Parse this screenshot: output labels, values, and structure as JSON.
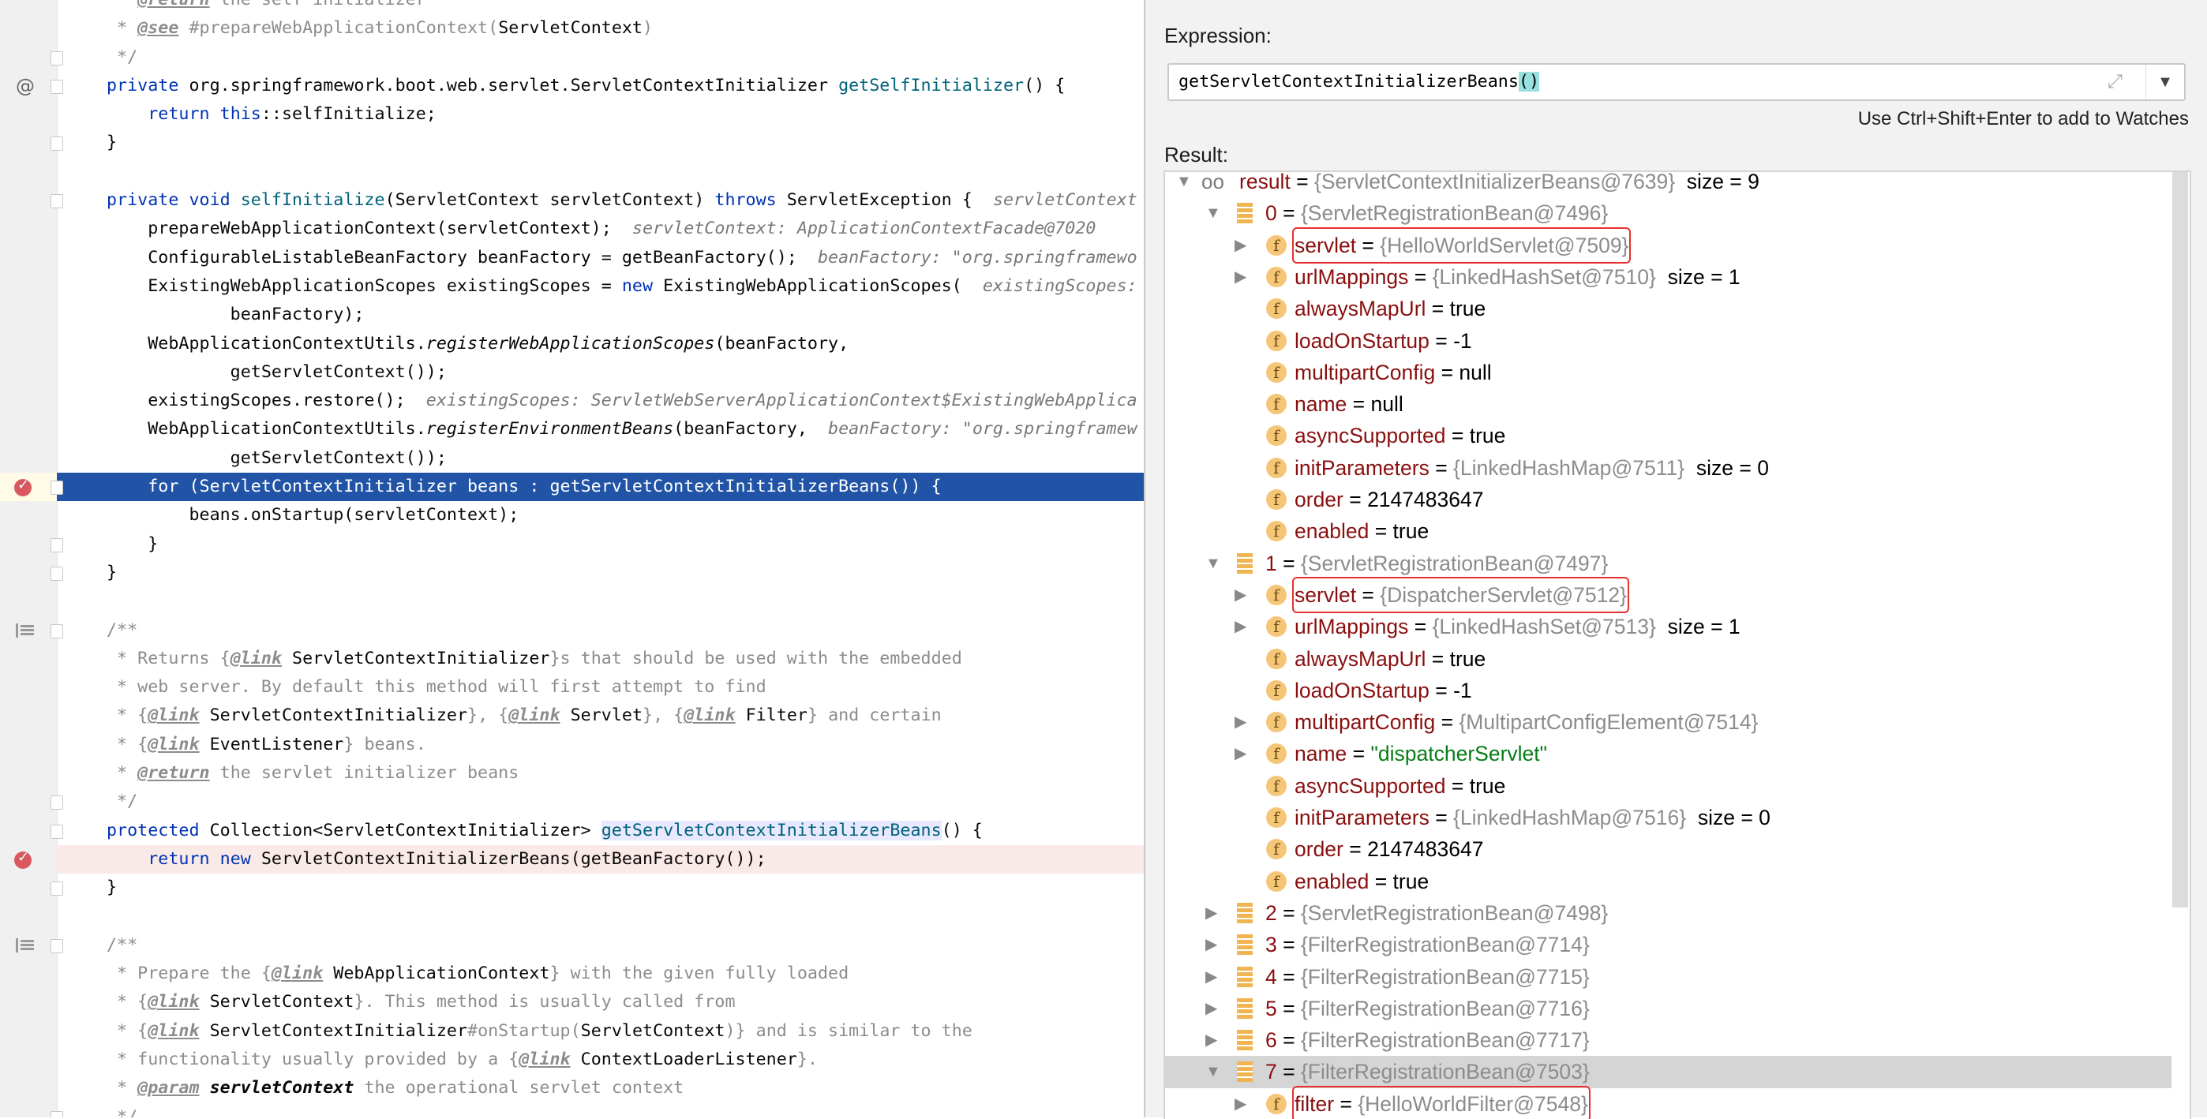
{
  "editor": {
    "lines": [
      [
        [
          " * ",
          "c"
        ],
        [
          "@return",
          "t"
        ],
        [
          " the self initializer",
          "c"
        ]
      ],
      [
        [
          " * ",
          "c"
        ],
        [
          "@see",
          "t"
        ],
        [
          " #prepareWebApplicationContext(",
          "c"
        ],
        [
          "ServletContext",
          "p"
        ],
        [
          ")",
          "c"
        ]
      ],
      [
        [
          " */",
          "c"
        ]
      ],
      [
        [
          "private",
          "k"
        ],
        [
          " org.springframework.boot.web.servlet.ServletContextInitializer ",
          "p"
        ],
        [
          "getSelfInitializer",
          "m"
        ],
        [
          "() {",
          "p"
        ]
      ],
      [
        [
          "    ",
          "p"
        ],
        [
          "return",
          "k"
        ],
        [
          " ",
          "p"
        ],
        [
          "this",
          "k"
        ],
        [
          "::selfInitialize;",
          "p"
        ]
      ],
      [
        [
          "}",
          "p"
        ]
      ],
      [],
      [
        [
          "private void",
          "k"
        ],
        [
          " ",
          "p"
        ],
        [
          "selfInitialize",
          "m"
        ],
        [
          "(ServletContext servletContext) ",
          "p"
        ],
        [
          "throws",
          "k"
        ],
        [
          " ServletException {  ",
          "p"
        ],
        [
          "servletContext",
          "h"
        ]
      ],
      [
        [
          "    prepareWebApplicationContext(servletContext);  ",
          "p"
        ],
        [
          "servletContext: ApplicationContextFacade@7020",
          "h"
        ]
      ],
      [
        [
          "    ConfigurableListableBeanFactory beanFactory = getBeanFactory();  ",
          "p"
        ],
        [
          "beanFactory: \"org.springframewo",
          "h"
        ]
      ],
      [
        [
          "    ExistingWebApplicationScopes existingScopes = ",
          "p"
        ],
        [
          "new",
          "k"
        ],
        [
          " ExistingWebApplicationScopes(  ",
          "p"
        ],
        [
          "existingScopes:",
          "h"
        ]
      ],
      [
        [
          "            beanFactory);",
          "p"
        ]
      ],
      [
        [
          "    WebApplicationContextUtils.",
          "p"
        ],
        [
          "registerWebApplicationScopes",
          "i"
        ],
        [
          "(beanFactory,",
          "p"
        ]
      ],
      [
        [
          "            getServletContext());",
          "p"
        ]
      ],
      [
        [
          "    existingScopes.restore();  ",
          "p"
        ],
        [
          "existingScopes: ServletWebServerApplicationContext$ExistingWebApplica",
          "h"
        ]
      ],
      [
        [
          "    WebApplicationContextUtils.",
          "p"
        ],
        [
          "registerEnvironmentBeans",
          "i"
        ],
        [
          "(beanFactory,  ",
          "p"
        ],
        [
          "beanFactory: \"org.springframew",
          "h"
        ]
      ],
      [
        [
          "            getServletContext());",
          "p"
        ]
      ],
      [
        [
          "    for (ServletContextInitializer beans : getServletContextInitializerBeans()) {",
          "p"
        ]
      ],
      [
        [
          "        beans.onStartup(servletContext);",
          "p"
        ]
      ],
      [
        [
          "    }",
          "p"
        ]
      ],
      [
        [
          "}",
          "p"
        ]
      ],
      [],
      [
        [
          "/**",
          "c"
        ]
      ],
      [
        [
          " * Returns {",
          "c"
        ],
        [
          "@link",
          "t"
        ],
        [
          " ServletContextInitializer",
          "p"
        ],
        [
          "}s that should be used with the embedded",
          "c"
        ]
      ],
      [
        [
          " * web server. By default this method will first attempt to find",
          "c"
        ]
      ],
      [
        [
          " * {",
          "c"
        ],
        [
          "@link",
          "t"
        ],
        [
          " ServletContextInitializer",
          "p"
        ],
        [
          "}, {",
          "c"
        ],
        [
          "@link",
          "t"
        ],
        [
          " Servlet",
          "p"
        ],
        [
          "}, {",
          "c"
        ],
        [
          "@link",
          "t"
        ],
        [
          " Filter",
          "p"
        ],
        [
          "} and certain",
          "c"
        ]
      ],
      [
        [
          " * {",
          "c"
        ],
        [
          "@link",
          "t"
        ],
        [
          " EventListener",
          "p"
        ],
        [
          "} beans.",
          "c"
        ]
      ],
      [
        [
          " * ",
          "c"
        ],
        [
          "@return",
          "t"
        ],
        [
          " the servlet initializer beans",
          "c"
        ]
      ],
      [
        [
          " */",
          "c"
        ]
      ],
      [
        [
          "protected",
          "k"
        ],
        [
          " Collection<ServletContextInitializer> ",
          "p"
        ],
        [
          "getServletContextInitializerBeans",
          "mh"
        ],
        [
          "() {",
          "p"
        ]
      ],
      [
        [
          "    ",
          "p"
        ],
        [
          "return new",
          "k"
        ],
        [
          " ServletContextInitializerBeans(getBeanFactory());",
          "p"
        ]
      ],
      [
        [
          "}",
          "p"
        ]
      ],
      [],
      [
        [
          "/**",
          "c"
        ]
      ],
      [
        [
          " * Prepare the {",
          "c"
        ],
        [
          "@link",
          "t"
        ],
        [
          " WebApplicationContext",
          "p"
        ],
        [
          "} with the given fully loaded",
          "c"
        ]
      ],
      [
        [
          " * {",
          "c"
        ],
        [
          "@link",
          "t"
        ],
        [
          " ServletContext",
          "p"
        ],
        [
          "}. This method is usually called from",
          "c"
        ]
      ],
      [
        [
          " * {",
          "c"
        ],
        [
          "@link",
          "t"
        ],
        [
          " ServletContextInitializer",
          "p"
        ],
        [
          "#onStartup(",
          "c"
        ],
        [
          "ServletContext",
          "p"
        ],
        [
          ")} and is similar to the",
          "c"
        ]
      ],
      [
        [
          " * functionality usually provided by a {",
          "c"
        ],
        [
          "@link",
          "t"
        ],
        [
          " ContextLoaderListener",
          "p"
        ],
        [
          "}.",
          "c"
        ]
      ],
      [
        [
          " * ",
          "c"
        ],
        [
          "@param",
          "t"
        ],
        [
          " ",
          "p"
        ],
        [
          "servletContext",
          "pb"
        ],
        [
          " the operational servlet context",
          "c"
        ]
      ],
      [
        [
          " */",
          "c"
        ]
      ]
    ],
    "execution_line": 17,
    "breakpoint_lines": [
      17,
      30
    ],
    "override_icon_lines": [
      3
    ],
    "doc_icon_lines": [
      22,
      33
    ],
    "fold_lines": [
      2,
      3,
      5,
      7,
      17,
      19,
      20,
      22,
      28,
      29,
      31,
      33,
      39
    ]
  },
  "evaluate": {
    "expression_label": "Expression:",
    "expression_value": "getServletContextInitializerBeans",
    "expression_parens": "()",
    "hint": "Use Ctrl+Shift+Enter to add to Watches",
    "result_label": "Result:"
  },
  "tree": [
    {
      "level": 0,
      "arrow": "down",
      "icon": "watch",
      "name": "result",
      "value": "{ServletContextInitializerBeans@7639}",
      "vclass": "ref",
      "extra": "size = 9"
    },
    {
      "level": 1,
      "arrow": "down",
      "icon": "array",
      "name": "0",
      "value": "{ServletRegistrationBean@7496}",
      "vclass": "ref"
    },
    {
      "level": 2,
      "arrow": "right",
      "icon": "field",
      "name": "servlet",
      "value": "{HelloWorldServlet@7509}",
      "vclass": "ref",
      "boxed": true
    },
    {
      "level": 2,
      "arrow": "right",
      "icon": "field",
      "name": "urlMappings",
      "value": "{LinkedHashSet@7510}",
      "vclass": "ref",
      "extra": "size = 1"
    },
    {
      "level": 2,
      "arrow": "none",
      "icon": "field",
      "name": "alwaysMapUrl",
      "value": "true",
      "vclass": "plain"
    },
    {
      "level": 2,
      "arrow": "none",
      "icon": "field",
      "name": "loadOnStartup",
      "value": "-1",
      "vclass": "plain"
    },
    {
      "level": 2,
      "arrow": "none",
      "icon": "field",
      "name": "multipartConfig",
      "value": "null",
      "vclass": "plain"
    },
    {
      "level": 2,
      "arrow": "none",
      "icon": "field",
      "name": "name",
      "value": "null",
      "vclass": "plain"
    },
    {
      "level": 2,
      "arrow": "none",
      "icon": "field",
      "name": "asyncSupported",
      "value": "true",
      "vclass": "plain"
    },
    {
      "level": 2,
      "arrow": "none",
      "icon": "field",
      "name": "initParameters",
      "value": "{LinkedHashMap@7511}",
      "vclass": "ref",
      "extra": "size = 0"
    },
    {
      "level": 2,
      "arrow": "none",
      "icon": "field",
      "name": "order",
      "value": "2147483647",
      "vclass": "plain"
    },
    {
      "level": 2,
      "arrow": "none",
      "icon": "field",
      "name": "enabled",
      "value": "true",
      "vclass": "plain"
    },
    {
      "level": 1,
      "arrow": "down",
      "icon": "array",
      "name": "1",
      "value": "{ServletRegistrationBean@7497}",
      "vclass": "ref"
    },
    {
      "level": 2,
      "arrow": "right",
      "icon": "field",
      "name": "servlet",
      "value": "{DispatcherServlet@7512}",
      "vclass": "ref",
      "boxed": true
    },
    {
      "level": 2,
      "arrow": "right",
      "icon": "field",
      "name": "urlMappings",
      "value": "{LinkedHashSet@7513}",
      "vclass": "ref",
      "extra": "size = 1"
    },
    {
      "level": 2,
      "arrow": "none",
      "icon": "field",
      "name": "alwaysMapUrl",
      "value": "true",
      "vclass": "plain"
    },
    {
      "level": 2,
      "arrow": "none",
      "icon": "field",
      "name": "loadOnStartup",
      "value": "-1",
      "vclass": "plain"
    },
    {
      "level": 2,
      "arrow": "right",
      "icon": "field",
      "name": "multipartConfig",
      "value": "{MultipartConfigElement@7514}",
      "vclass": "ref"
    },
    {
      "level": 2,
      "arrow": "right",
      "icon": "field",
      "name": "name",
      "value": "\"dispatcherServlet\"",
      "vclass": "str"
    },
    {
      "level": 2,
      "arrow": "none",
      "icon": "field",
      "name": "asyncSupported",
      "value": "true",
      "vclass": "plain"
    },
    {
      "level": 2,
      "arrow": "none",
      "icon": "field",
      "name": "initParameters",
      "value": "{LinkedHashMap@7516}",
      "vclass": "ref",
      "extra": "size = 0"
    },
    {
      "level": 2,
      "arrow": "none",
      "icon": "field",
      "name": "order",
      "value": "2147483647",
      "vclass": "plain"
    },
    {
      "level": 2,
      "arrow": "none",
      "icon": "field",
      "name": "enabled",
      "value": "true",
      "vclass": "plain"
    },
    {
      "level": 1,
      "arrow": "right",
      "icon": "array",
      "name": "2",
      "value": "{ServletRegistrationBean@7498}",
      "vclass": "ref"
    },
    {
      "level": 1,
      "arrow": "right",
      "icon": "array",
      "name": "3",
      "value": "{FilterRegistrationBean@7714}",
      "vclass": "ref"
    },
    {
      "level": 1,
      "arrow": "right",
      "icon": "array",
      "name": "4",
      "value": "{FilterRegistrationBean@7715}",
      "vclass": "ref"
    },
    {
      "level": 1,
      "arrow": "right",
      "icon": "array",
      "name": "5",
      "value": "{FilterRegistrationBean@7716}",
      "vclass": "ref"
    },
    {
      "level": 1,
      "arrow": "right",
      "icon": "array",
      "name": "6",
      "value": "{FilterRegistrationBean@7717}",
      "vclass": "ref"
    },
    {
      "level": 1,
      "arrow": "down",
      "icon": "array",
      "name": "7",
      "value": "{FilterRegistrationBean@7503}",
      "vclass": "ref",
      "selected": true
    },
    {
      "level": 2,
      "arrow": "right",
      "icon": "field",
      "name": "filter",
      "value": "{HelloWorldFilter@7548}",
      "vclass": "ref",
      "boxed": true
    }
  ]
}
